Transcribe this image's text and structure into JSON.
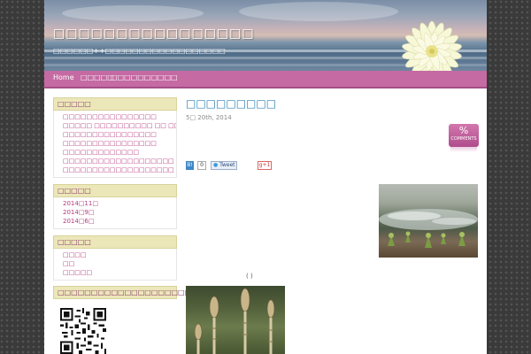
{
  "header": {
    "site_title": "□□□□□□□□□□□□□□□□",
    "site_description": "□□□□□□++□□□□□□□□□□□□□□□□□□"
  },
  "nav": {
    "items": [
      {
        "label": "Home"
      },
      {
        "label": "□□□□□"
      },
      {
        "label": "□□□□□□□□□□"
      }
    ]
  },
  "sidebar": {
    "widgets": [
      {
        "title": "□□□□□",
        "links": [
          "□□□□□□□□□□□□□□□□",
          "□□□□□ □□□□□□□□□□ □□ □□□□□□□□□□□□□□",
          "□□□□□□□□□□□□□□□□",
          "□□□□□□□□□□□□□□□□",
          "□□□□□□□□□□□□□",
          "□□□□□□□□□□□□□□□□□□□",
          "□□□□□□□□□□□□□□□□□□□"
        ]
      },
      {
        "title": "□□□□□",
        "links": [
          "2014□11□",
          "2014□9□",
          "2014□6□"
        ]
      },
      {
        "title": "□□□□□",
        "links": [
          "□□□□",
          "□□",
          "□□□□□"
        ]
      },
      {
        "title": "□□□□□□□□□□□□□□□□□□□□□",
        "links": []
      }
    ]
  },
  "post": {
    "title": "□□□□□□□□□",
    "date": "5□ 20th, 2014",
    "comments_badge": {
      "symbol": "%",
      "label": "COMMENTS"
    },
    "share": {
      "hatena": "B!",
      "count": "0",
      "tweet": "Tweet",
      "gplus": "g+1"
    },
    "caption": "( )"
  },
  "colors": {
    "accent": "#c56aa3",
    "link": "#b2397f",
    "title_link": "#2a7fb2",
    "widget_title_bg": "#ece7b9"
  }
}
